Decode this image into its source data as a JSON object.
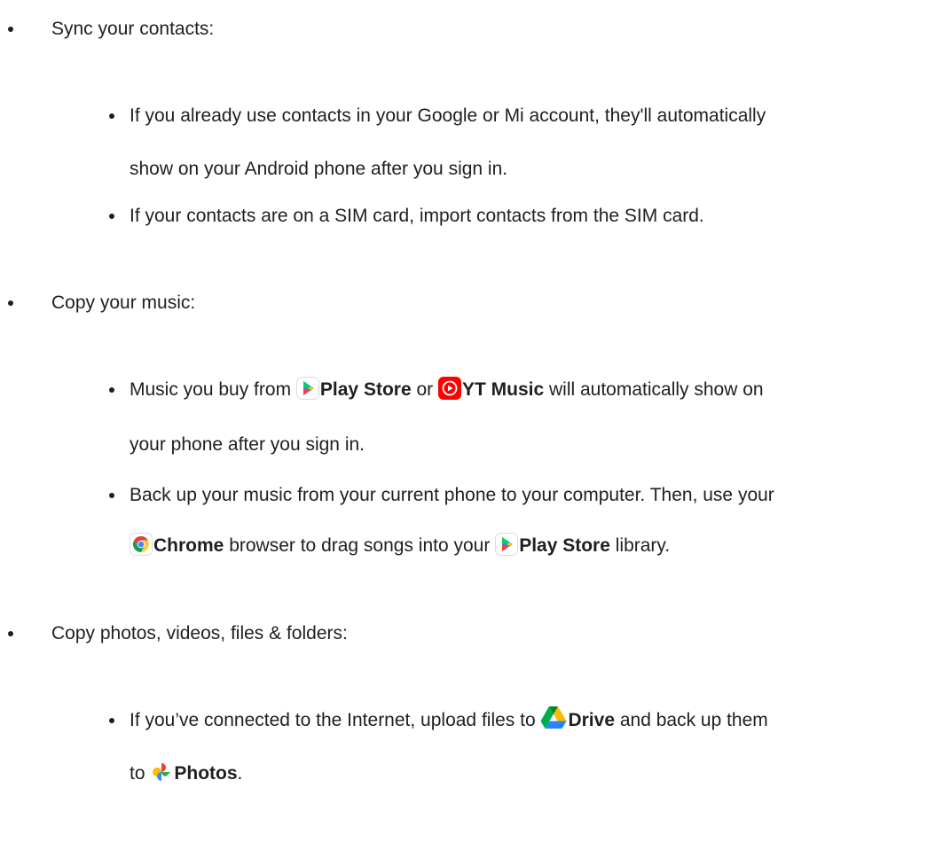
{
  "sections": [
    {
      "heading": "Sync your contacts:",
      "items": [
        {
          "line1": "If you already use contacts in your Google or Mi account, they'll automatically",
          "line2": "show on your Android phone after you sign in."
        },
        {
          "line1": "If your contacts are on a SIM card, import contacts from the SIM card."
        }
      ]
    },
    {
      "heading": "Copy your music:",
      "items": [
        {
          "l1_pre": "Music you buy from ",
          "l1_app1": "Play Store",
          "l1_mid": " or ",
          "l1_app2": "YT Music",
          "l1_post": " will automatically show on",
          "line2": "your phone after you sign in.",
          "icon1": "play-store-icon",
          "icon2": "yt-music-icon"
        },
        {
          "line1": "Back up your music from your current phone to your computer. Then, use your",
          "l2_app1": "Chrome",
          "l2_mid": " browser to drag songs into your ",
          "l2_app2": "Play Store",
          "l2_post": " library.",
          "icon1": "chrome-icon",
          "icon2": "play-store-icon"
        }
      ]
    },
    {
      "heading": "Copy photos, videos, files & folders:",
      "items": [
        {
          "l1_pre": "If you’ve connected to the Internet, upload files to ",
          "l1_app": "Drive",
          "l1_post": " and back up them",
          "l2_pre": "to ",
          "l2_app": "Photos",
          "l2_post": ".",
          "icon1": "google-drive-icon",
          "icon2": "google-photos-icon"
        }
      ]
    }
  ]
}
